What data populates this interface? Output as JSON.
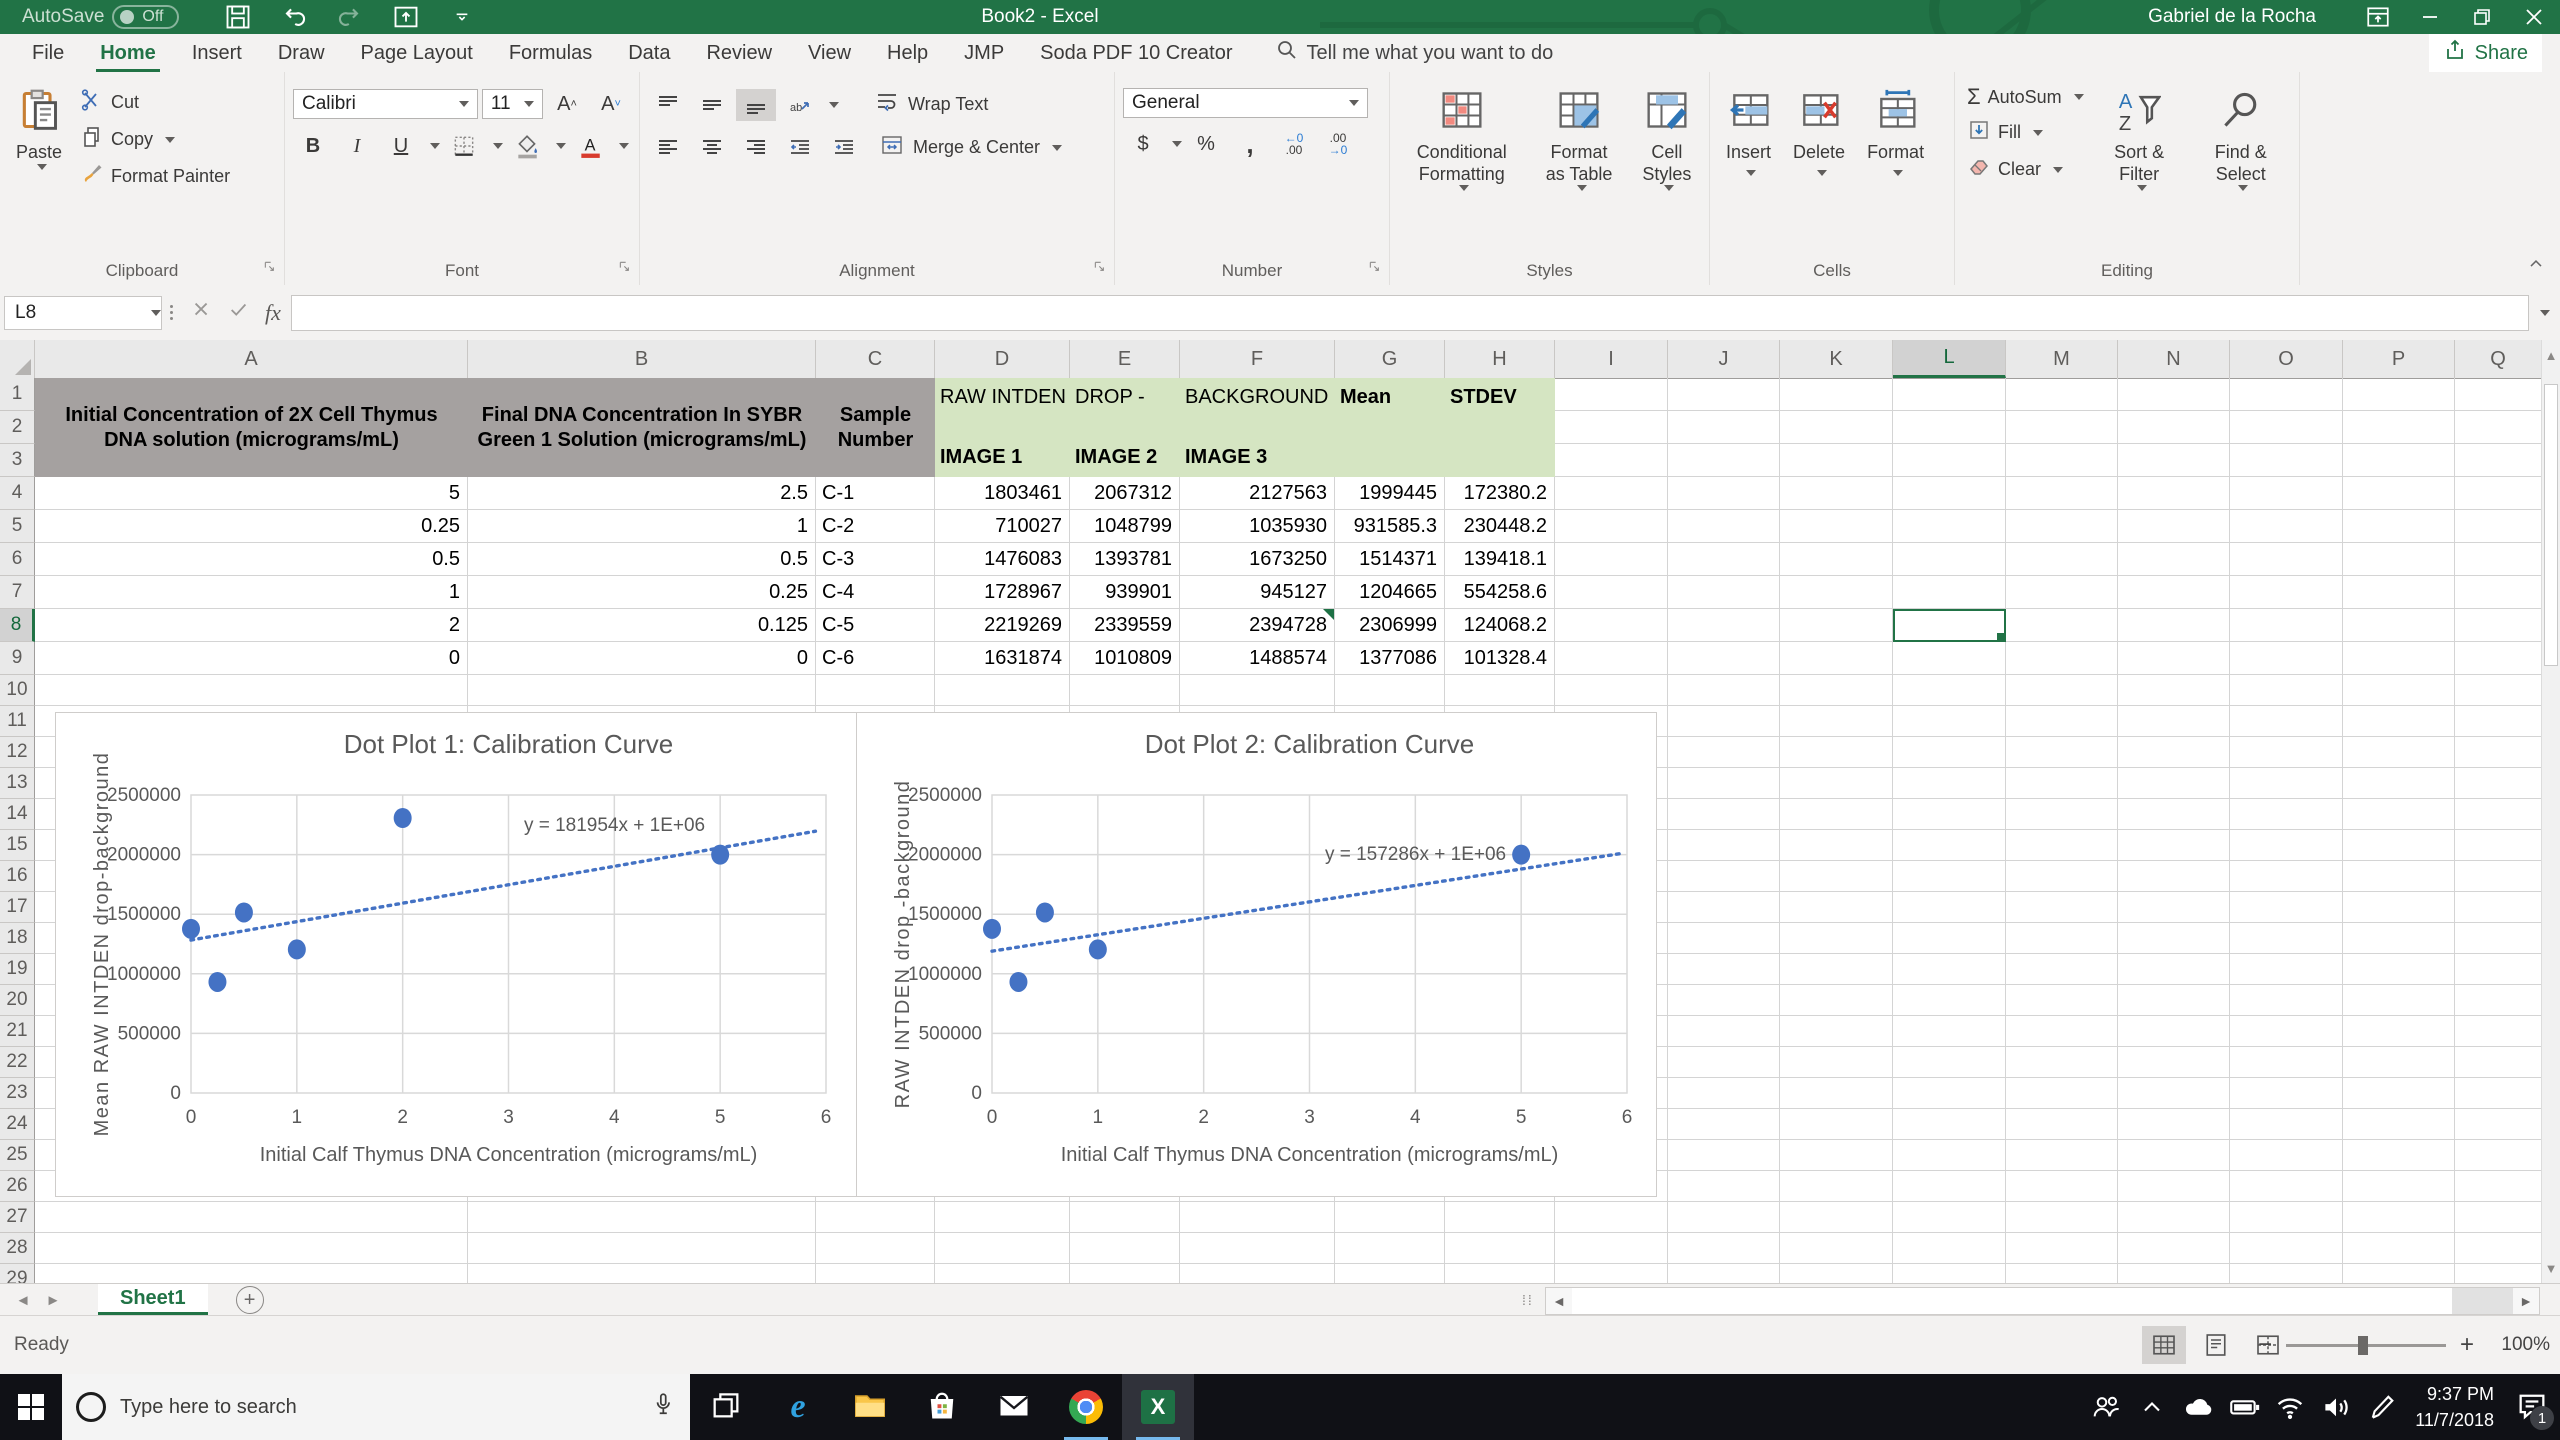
{
  "titlebar": {
    "autosave_label": "AutoSave",
    "autosave_state": "Off",
    "title": "Book2 - Excel",
    "user": "Gabriel de la Rocha"
  },
  "ribbon": {
    "tabs": [
      "File",
      "Home",
      "Insert",
      "Draw",
      "Page Layout",
      "Formulas",
      "Data",
      "Review",
      "View",
      "Help",
      "JMP",
      "Soda PDF 10 Creator"
    ],
    "active_tab": "Home",
    "search_placeholder": "Tell me what you want to do",
    "share_label": "Share",
    "clipboard": {
      "label": "Clipboard",
      "paste": "Paste",
      "cut": "Cut",
      "copy": "Copy",
      "format_painter": "Format Painter"
    },
    "font": {
      "label": "Font",
      "font_name": "Calibri",
      "font_size": "11",
      "bold": "B",
      "italic": "I",
      "underline": "U"
    },
    "alignment": {
      "label": "Alignment",
      "wrap_text": "Wrap Text",
      "merge_center": "Merge & Center"
    },
    "number": {
      "label": "Number",
      "format": "General"
    },
    "styles": {
      "label": "Styles",
      "conditional": "Conditional Formatting",
      "format_table": "Format as Table",
      "cell_styles": "Cell Styles"
    },
    "cells": {
      "label": "Cells",
      "insert": "Insert",
      "delete": "Delete",
      "format": "Format"
    },
    "editing": {
      "label": "Editing",
      "autosum": "AutoSum",
      "fill": "Fill",
      "clear": "Clear",
      "sort_filter": "Sort & Filter",
      "find_select": "Find & Select"
    }
  },
  "formula_bar": {
    "name_box": "L8",
    "fx_label": "fx",
    "value": ""
  },
  "grid": {
    "columns": [
      "A",
      "B",
      "C",
      "D",
      "E",
      "F",
      "G",
      "H",
      "I",
      "J",
      "K",
      "L",
      "M",
      "N",
      "O",
      "P",
      "Q"
    ],
    "row_count": 29,
    "selected_cell": {
      "column": "L",
      "row": 8
    },
    "flag_cell": {
      "column": "F",
      "row": 8
    },
    "header": {
      "a": "Initial Concentration of 2X Cell Thymus DNA solution (micrograms/mL)",
      "b": "Final DNA Concentration In SYBR Green 1 Solution (micrograms/mL)",
      "c": "Sample Number",
      "d1": "RAW INTDEN",
      "e1": "DROP -",
      "f1": "BACKGROUND",
      "g1": "Mean",
      "h1": "STDEV",
      "d3": "IMAGE 1",
      "e3": "IMAGE 2",
      "f3": "IMAGE 3"
    },
    "rows": [
      {
        "row": 4,
        "values": [
          "5",
          "2.5",
          "C-1",
          "1803461",
          "2067312",
          "2127563",
          "1999445",
          "172380.2"
        ]
      },
      {
        "row": 5,
        "values": [
          "0.25",
          "1",
          "C-2",
          "710027",
          "1048799",
          "1035930",
          "931585.3",
          "230448.2"
        ]
      },
      {
        "row": 6,
        "values": [
          "0.5",
          "0.5",
          "C-3",
          "1476083",
          "1393781",
          "1673250",
          "1514371",
          "139418.1"
        ]
      },
      {
        "row": 7,
        "values": [
          "1",
          "0.25",
          "C-4",
          "1728967",
          "939901",
          "945127",
          "1204665",
          "554258.6"
        ]
      },
      {
        "row": 8,
        "values": [
          "2",
          "0.125",
          "C-5",
          "2219269",
          "2339559",
          "2394728",
          "2306999",
          "124068.2"
        ]
      },
      {
        "row": 9,
        "values": [
          "0",
          "0",
          "C-6",
          "1631874",
          "1010809",
          "1488574",
          "1377086",
          "101328.4"
        ]
      }
    ]
  },
  "chart_data": [
    {
      "type": "scatter",
      "title": "Dot Plot 1: Calibration Curve",
      "xlabel": "Initial Calf Thymus DNA Concentration (micrograms/mL)",
      "ylabel": "Mean RAW INTDEN drop-background",
      "xlim": [
        0,
        6
      ],
      "ylim": [
        0,
        2500000
      ],
      "xticks": [
        0,
        1,
        2,
        3,
        4,
        5,
        6
      ],
      "yticks": [
        0,
        500000,
        1000000,
        1500000,
        2000000,
        2500000
      ],
      "points": [
        [
          0,
          1377086
        ],
        [
          0.25,
          931585.3
        ],
        [
          0.5,
          1514371
        ],
        [
          1,
          1204665
        ],
        [
          2,
          2306999
        ],
        [
          5,
          1999445
        ]
      ],
      "equation": "y = 181954x + 1E+06",
      "equation_pos": [
        0.667,
        0.12
      ],
      "trendline": {
        "x1": 0,
        "y1": 1283000,
        "x2": 5.9,
        "y2": 2196000
      },
      "grid": true,
      "legend": false,
      "marker_color": "#4472c4"
    },
    {
      "type": "scatter",
      "title": "Dot Plot 2: Calibration Curve",
      "xlabel": "Initial Calf Thymus DNA Concentration (micrograms/mL)",
      "ylabel": "RAW INTDEN drop -background",
      "xlim": [
        0,
        6
      ],
      "ylim": [
        0,
        2500000
      ],
      "xticks": [
        0,
        1,
        2,
        3,
        4,
        5,
        6
      ],
      "yticks": [
        0,
        500000,
        1000000,
        1500000,
        2000000,
        2500000
      ],
      "points": [
        [
          0,
          1377086
        ],
        [
          0.25,
          931585.3
        ],
        [
          0.5,
          1514371
        ],
        [
          1,
          1204665
        ],
        [
          5,
          1999445
        ]
      ],
      "equation": "y = 157286x + 1E+06",
      "equation_pos": [
        0.667,
        0.218
      ],
      "trendline": {
        "x1": 0,
        "y1": 1190000,
        "x2": 5.95,
        "y2": 2010000
      },
      "grid": true,
      "legend": false,
      "marker_color": "#4472c4"
    }
  ],
  "sheet_tabs": {
    "active": "Sheet1"
  },
  "status_bar": {
    "status": "Ready",
    "zoom_level": "100%"
  },
  "taskbar": {
    "search_placeholder": "Type here to search",
    "app_icons": [
      "task-view",
      "edge",
      "file-explorer",
      "store",
      "mail",
      "chrome",
      "excel"
    ],
    "open_apps": [
      "chrome",
      "excel"
    ],
    "active_app": "excel",
    "tray_icons": [
      "people",
      "chevron-up",
      "onedrive",
      "battery",
      "wifi",
      "volume",
      "pen"
    ],
    "time": "9:37 PM",
    "date": "11/7/2018",
    "notification_count": "1"
  }
}
